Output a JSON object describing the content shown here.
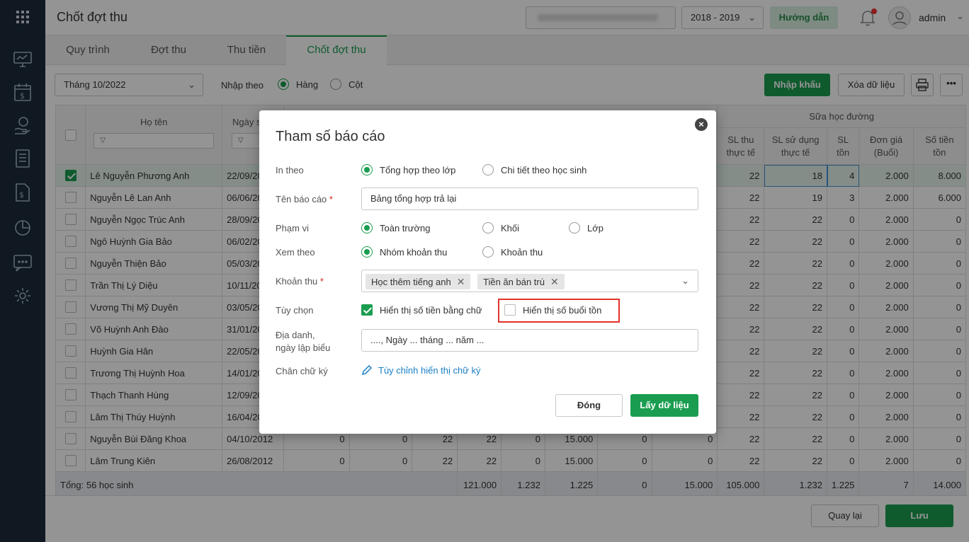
{
  "header": {
    "page_title": "Chốt đợt thu",
    "year": "2018 - 2019",
    "guide_label": "Hướng dẫn",
    "user_name": "admin"
  },
  "tabs": [
    {
      "label": "Quy trình"
    },
    {
      "label": "Đợt thu"
    },
    {
      "label": "Thu tiền"
    },
    {
      "label": "Chốt đợt thu"
    }
  ],
  "toolbar": {
    "month": "Tháng 10/2022",
    "input_by_label": "Nhập theo",
    "opt_row": "Hàng",
    "opt_col": "Cột",
    "import_label": "Nhập khẩu",
    "delete_label": "Xóa dữ liệu"
  },
  "table": {
    "col_name": "Họ tên",
    "col_dob": "Ngày sinh",
    "group_milk": "Sữa học đường",
    "col_sl_thu": "SL thu thực tế",
    "col_sl_sd": "SL sử dụng thực tế",
    "col_sl_ton": "SL tồn",
    "col_don_gia": "Đơn giá (Buổi)",
    "col_so_tien": "Số tiền tồn",
    "rows": [
      {
        "name": "Lê Nguyễn Phương Anh",
        "dob": "22/09/20",
        "c1": "",
        "c2": "",
        "c3": "",
        "c4": "",
        "c5": "",
        "c6": "",
        "c7": "",
        "sl_thu": "22",
        "sl_sd": "18",
        "sl_ton": "4",
        "don_gia": "2.000",
        "so_tien": "8.000"
      },
      {
        "name": "Nguyễn Lê  Lan Anh",
        "dob": "06/06/20",
        "c1": "",
        "c2": "",
        "c3": "",
        "c4": "",
        "c5": "",
        "c6": "",
        "c7": "",
        "sl_thu": "22",
        "sl_sd": "19",
        "sl_ton": "3",
        "don_gia": "2.000",
        "so_tien": "6.000"
      },
      {
        "name": "Nguyễn Ngọc Trúc Anh",
        "dob": "28/09/20",
        "c1": "",
        "c2": "",
        "c3": "",
        "c4": "",
        "c5": "",
        "c6": "",
        "c7": "",
        "sl_thu": "22",
        "sl_sd": "22",
        "sl_ton": "0",
        "don_gia": "2.000",
        "so_tien": "0"
      },
      {
        "name": "Ngô Huỳnh Gia Bảo",
        "dob": "06/02/20",
        "c1": "",
        "c2": "",
        "c3": "",
        "c4": "",
        "c5": "",
        "c6": "",
        "c7": "",
        "sl_thu": "22",
        "sl_sd": "22",
        "sl_ton": "0",
        "don_gia": "2.000",
        "so_tien": "0"
      },
      {
        "name": "Nguyễn Thiện Bảo",
        "dob": "05/03/20",
        "c1": "",
        "c2": "",
        "c3": "",
        "c4": "",
        "c5": "",
        "c6": "",
        "c7": "",
        "sl_thu": "22",
        "sl_sd": "22",
        "sl_ton": "0",
        "don_gia": "2.000",
        "so_tien": "0"
      },
      {
        "name": "Trần Thị Lý Diệu",
        "dob": "10/11/20",
        "c1": "",
        "c2": "",
        "c3": "",
        "c4": "",
        "c5": "",
        "c6": "",
        "c7": "",
        "sl_thu": "22",
        "sl_sd": "22",
        "sl_ton": "0",
        "don_gia": "2.000",
        "so_tien": "0"
      },
      {
        "name": "Vương Thị Mỹ Duyên",
        "dob": "03/05/20",
        "c1": "",
        "c2": "",
        "c3": "",
        "c4": "",
        "c5": "",
        "c6": "",
        "c7": "",
        "sl_thu": "22",
        "sl_sd": "22",
        "sl_ton": "0",
        "don_gia": "2.000",
        "so_tien": "0"
      },
      {
        "name": "Võ Huỳnh Anh Đào",
        "dob": "31/01/20",
        "c1": "",
        "c2": "",
        "c3": "",
        "c4": "",
        "c5": "",
        "c6": "",
        "c7": "",
        "sl_thu": "22",
        "sl_sd": "22",
        "sl_ton": "0",
        "don_gia": "2.000",
        "so_tien": "0"
      },
      {
        "name": "Huỳnh Gia Hân",
        "dob": "22/05/20",
        "c1": "",
        "c2": "",
        "c3": "",
        "c4": "",
        "c5": "",
        "c6": "",
        "c7": "",
        "sl_thu": "22",
        "sl_sd": "22",
        "sl_ton": "0",
        "don_gia": "2.000",
        "so_tien": "0"
      },
      {
        "name": "Trương Thị Huỳnh Hoa",
        "dob": "14/01/20",
        "c1": "",
        "c2": "",
        "c3": "",
        "c4": "",
        "c5": "",
        "c6": "",
        "c7": "",
        "sl_thu": "22",
        "sl_sd": "22",
        "sl_ton": "0",
        "don_gia": "2.000",
        "so_tien": "0"
      },
      {
        "name": "Thạch Thanh Hùng",
        "dob": "12/09/20",
        "c1": "",
        "c2": "",
        "c3": "",
        "c4": "",
        "c5": "",
        "c6": "",
        "c7": "",
        "sl_thu": "22",
        "sl_sd": "22",
        "sl_ton": "0",
        "don_gia": "2.000",
        "so_tien": "0"
      },
      {
        "name": "Lâm Thị Thúy Huỳnh",
        "dob": "16/04/20",
        "c1": "",
        "c2": "",
        "c3": "",
        "c4": "",
        "c5": "",
        "c6": "",
        "c7": "",
        "sl_thu": "22",
        "sl_sd": "22",
        "sl_ton": "0",
        "don_gia": "2.000",
        "so_tien": "0"
      },
      {
        "name": "Nguyễn Bùi Đăng Khoa",
        "dob": "04/10/2012",
        "c1": "0",
        "c2": "0",
        "c3": "22",
        "c4": "22",
        "c5": "0",
        "c6": "15.000",
        "c7": "0",
        "c8": "0",
        "sl_thu": "22",
        "sl_sd": "22",
        "sl_ton": "0",
        "don_gia": "2.000",
        "so_tien": "0"
      },
      {
        "name": "Lâm Trung Kiên",
        "dob": "26/08/2012",
        "c1": "0",
        "c2": "0",
        "c3": "22",
        "c4": "22",
        "c5": "0",
        "c6": "15.000",
        "c7": "0",
        "c8": "0",
        "sl_thu": "22",
        "sl_sd": "22",
        "sl_ton": "0",
        "don_gia": "2.000",
        "so_tien": "0"
      }
    ],
    "total": {
      "label": "Tổng: 56 học sinh",
      "t1": "121.000",
      "t2": "1.232",
      "t3": "1.225",
      "t4": "0",
      "t5": "15.000",
      "t6": "105.000",
      "sl_thu": "1.232",
      "sl_sd": "1.225",
      "sl_ton": "7",
      "so_tien": "14.000"
    }
  },
  "footer": {
    "back_label": "Quay lại",
    "save_label": "Lưu"
  },
  "modal": {
    "title": "Tham số báo cáo",
    "print_by_label": "In theo",
    "print_opt1": "Tổng hợp theo lớp",
    "print_opt2": "Chi tiết theo học sinh",
    "report_name_label": "Tên báo cáo",
    "report_name_value": "Bảng tổng hợp trả lại",
    "scope_label": "Phạm vi",
    "scope_opt1": "Toàn trường",
    "scope_opt2": "Khối",
    "scope_opt3": "Lớp",
    "view_by_label": "Xem theo",
    "view_opt1": "Nhóm khoản thu",
    "view_opt2": "Khoản thu",
    "fee_label": "Khoản thu",
    "fee_tag1": "Học thêm tiếng anh",
    "fee_tag2": "Tiền ăn bán trú",
    "options_label": "Tùy chọn",
    "option1": "Hiển thị số tiền bằng chữ",
    "option2": "Hiển thị số buổi tồn",
    "place_label_1": "Địa danh,",
    "place_label_2": "ngày lập biểu",
    "place_value": "...., Ngày ... tháng ... năm ...",
    "signature_label": "Chân chữ ký",
    "signature_link": "Tùy chỉnh hiển thị chữ ký",
    "close_label": "Đóng",
    "fetch_label": "Lấy dữ liệu"
  },
  "colors": {
    "accent": "#1a9d50",
    "sidebar": "#1d2b3a",
    "highlight": "#e0332b",
    "link": "#1a7fc6"
  }
}
